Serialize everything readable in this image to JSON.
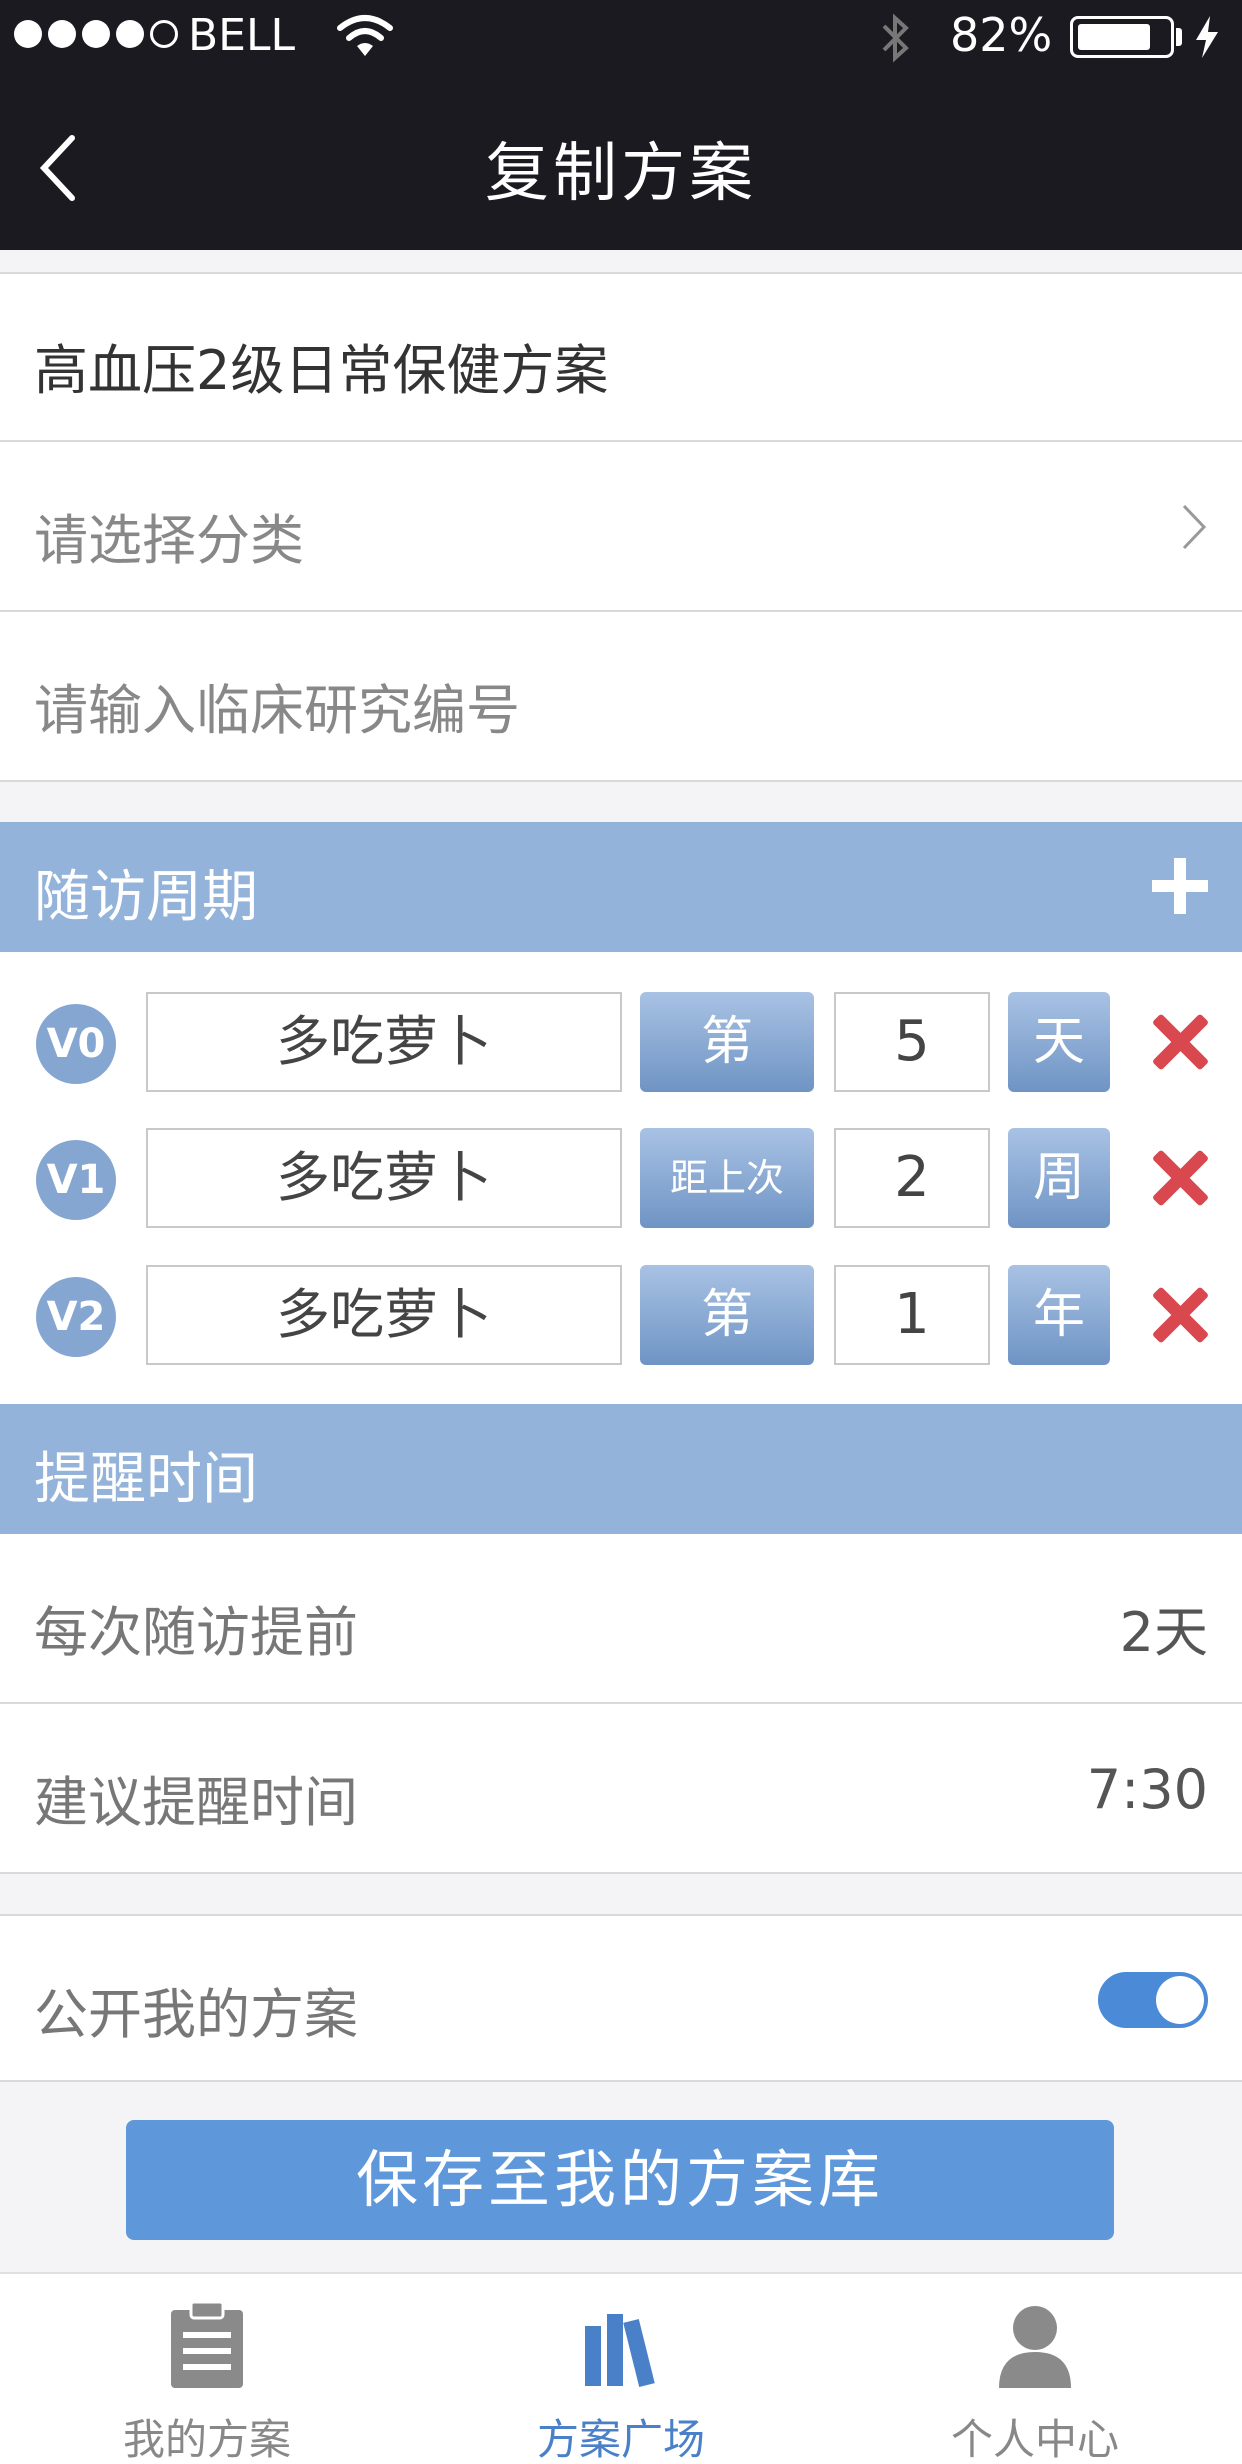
{
  "status_bar": {
    "carrier": "BELL",
    "battery": "82%",
    "battery_level": 0.82
  },
  "nav": {
    "title": "复制方案"
  },
  "form": {
    "plan_name": "高血压2级日常保健方案",
    "category_placeholder": "请选择分类",
    "clinical_placeholder": "请输入临床研究编号"
  },
  "followup": {
    "title": "随访周期",
    "visits": [
      {
        "badge": "V0",
        "name": "多吃萝卜",
        "mode": "第",
        "number": "5",
        "unit": "天"
      },
      {
        "badge": "V1",
        "name": "多吃萝卜",
        "mode": "距上次",
        "number": "2",
        "unit": "周"
      },
      {
        "badge": "V2",
        "name": "多吃萝卜",
        "mode": "第",
        "number": "1",
        "unit": "年"
      }
    ]
  },
  "reminder": {
    "title": "提醒时间",
    "advance_label": "每次随访提前",
    "advance_value": "2天",
    "time_label": "建议提醒时间",
    "time_value": "7:30"
  },
  "public": {
    "label": "公开我的方案",
    "enabled": true
  },
  "save_label": "保存至我的方案库",
  "tabs": [
    {
      "label": "我的方案",
      "icon": "clipboard-icon",
      "active": false
    },
    {
      "label": "方案广场",
      "icon": "books-icon",
      "active": true
    },
    {
      "label": "个人中心",
      "icon": "person-icon",
      "active": false
    }
  ],
  "colors": {
    "accent": "#5e98da",
    "section": "#93b3da",
    "delete": "#d9474f",
    "nav_bg": "#1b1a21"
  }
}
